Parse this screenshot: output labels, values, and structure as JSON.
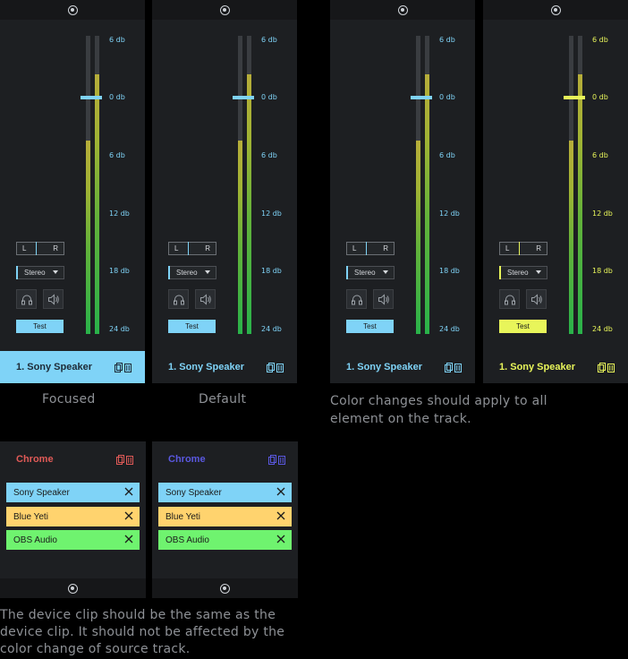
{
  "scale": [
    "6 db",
    "0 db",
    "6 db",
    "12 db",
    "18 db",
    "24 db"
  ],
  "lr": {
    "left": "L",
    "right": "R"
  },
  "stereo_label": "Stereo",
  "test_label": "Test",
  "device_name": "1. Sony Speaker",
  "states": [
    {
      "caption": "Focused",
      "accent": "#7fd3f7",
      "fill_left": 0.65,
      "fill_right": 0.87,
      "fader_level": "0 db"
    },
    {
      "caption": "Default",
      "accent": "#7fd3f7",
      "fill_left": 0.65,
      "fill_right": 0.87,
      "fader_level": "0 db"
    },
    {
      "caption": "",
      "accent": "#7fd3f7",
      "fill_left": 0.65,
      "fill_right": 0.87,
      "fader_level": "0 db"
    },
    {
      "caption": "",
      "accent": "#e8f55a",
      "fill_left": 0.65,
      "fill_right": 0.87,
      "fader_level": "0 db"
    }
  ],
  "color_change_note": "Color changes should apply to all element on the track.",
  "sources": [
    {
      "title": "Chrome",
      "title_color": "#e05a57"
    },
    {
      "title": "Chrome",
      "title_color": "#5a58e0"
    }
  ],
  "clips": [
    {
      "label": "Sony Speaker",
      "color": "#7fd3f7"
    },
    {
      "label": "Blue Yeti",
      "color": "#ffd36e"
    },
    {
      "label": "OBS Audio",
      "color": "#6ff36f"
    }
  ],
  "device_clip_note": "The device clip should be the same as the device clip. It should not be affected by the color change of source track.",
  "icons": [
    "record-ring-icon",
    "headphones-icon",
    "speaker-icon",
    "copy-icon",
    "trash-icon",
    "close-icon"
  ]
}
